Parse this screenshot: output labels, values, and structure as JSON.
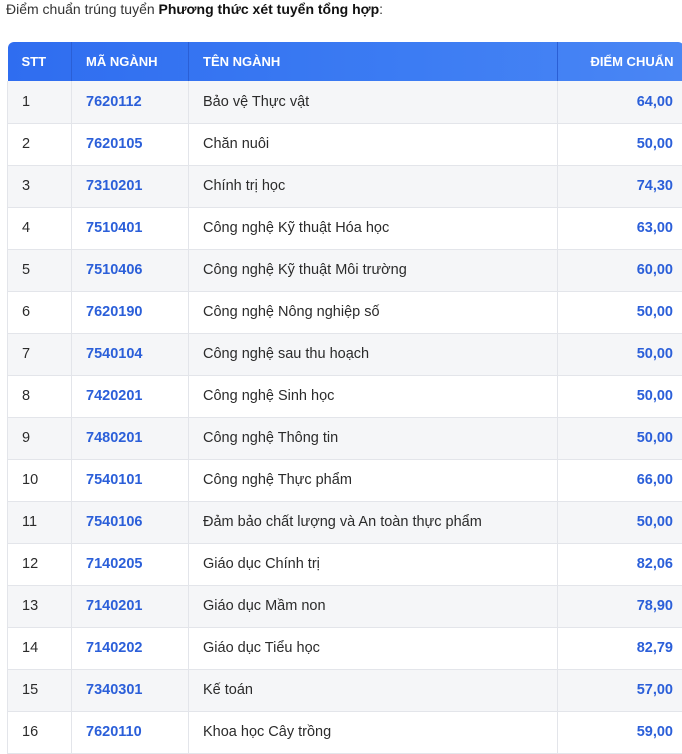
{
  "intro": {
    "prefix": "Điểm chuẩn trúng tuyển ",
    "method": "Phương thức xét tuyển tổng hợp",
    "suffix": ":"
  },
  "table": {
    "headers": [
      "STT",
      "MÃ NGÀNH",
      "TÊN NGÀNH",
      "ĐIỂM CHUẨN"
    ],
    "rows": [
      {
        "stt": "1",
        "code": "7620112",
        "name": "Bảo vệ Thực vật",
        "score": "64,00"
      },
      {
        "stt": "2",
        "code": "7620105",
        "name": "Chăn nuôi",
        "score": "50,00"
      },
      {
        "stt": "3",
        "code": "7310201",
        "name": "Chính trị học",
        "score": "74,30"
      },
      {
        "stt": "4",
        "code": "7510401",
        "name": "Công nghệ Kỹ thuật Hóa học",
        "score": "63,00"
      },
      {
        "stt": "5",
        "code": "7510406",
        "name": "Công nghệ Kỹ thuật Môi trường",
        "score": "60,00"
      },
      {
        "stt": "6",
        "code": "7620190",
        "name": "Công nghệ Nông nghiệp số",
        "score": "50,00"
      },
      {
        "stt": "7",
        "code": "7540104",
        "name": "Công nghệ sau thu hoạch",
        "score": "50,00"
      },
      {
        "stt": "8",
        "code": "7420201",
        "name": "Công nghệ Sinh học",
        "score": "50,00"
      },
      {
        "stt": "9",
        "code": "7480201",
        "name": "Công nghệ Thông tin",
        "score": "50,00"
      },
      {
        "stt": "10",
        "code": "7540101",
        "name": "Công nghệ Thực phẩm",
        "score": "66,00"
      },
      {
        "stt": "11",
        "code": "7540106",
        "name": "Đảm bảo chất lượng và An toàn thực phẩm",
        "score": "50,00"
      },
      {
        "stt": "12",
        "code": "7140205",
        "name": "Giáo dục Chính trị",
        "score": "82,06"
      },
      {
        "stt": "13",
        "code": "7140201",
        "name": "Giáo dục Mầm non",
        "score": "78,90"
      },
      {
        "stt": "14",
        "code": "7140202",
        "name": "Giáo dục Tiểu học",
        "score": "82,79"
      },
      {
        "stt": "15",
        "code": "7340301",
        "name": "Kế toán",
        "score": "57,00"
      },
      {
        "stt": "16",
        "code": "7620110",
        "name": "Khoa học Cây trồng",
        "score": "59,00"
      }
    ]
  }
}
